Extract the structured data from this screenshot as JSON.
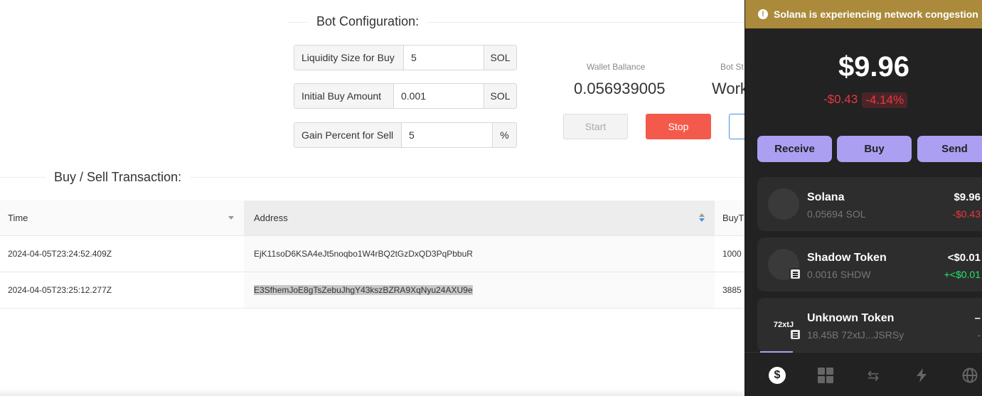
{
  "config": {
    "title": "Bot Configuration:",
    "fields": [
      {
        "label": "Liquidity Size for Buy",
        "value": "5",
        "unit": "SOL"
      },
      {
        "label": "Initial Buy Amount",
        "value": "0.001",
        "unit": "SOL"
      },
      {
        "label": "Gain Percent for Sell",
        "value": "5",
        "unit": "%"
      }
    ],
    "wallet_label": "Wallet Ballance",
    "wallet_value": "0.056939005",
    "bot_status_label": "Bot St",
    "bot_status_value": "Work",
    "start_label": "Start",
    "stop_label": "Stop"
  },
  "transactions": {
    "title": "Buy / Sell Transaction:",
    "columns": [
      "Time",
      "Address",
      "BuyT"
    ],
    "rows": [
      {
        "time": "2024-04-05T23:24:52.409Z",
        "address": "EjK11soD6KSA4eJt5noqbo1W4rBQ2tGzDxQD3PqPbbuR",
        "buy": "1000"
      },
      {
        "time": "2024-04-05T23:25:12.277Z",
        "address": "E3SfhemJoE8gTsZebuJhgY43kszBZRA9XqNyu24AXU9e",
        "buy": "3885"
      }
    ]
  },
  "wallet": {
    "banner": "Solana is experiencing network congestion",
    "balance": "$9.96",
    "change_abs": "-$0.43",
    "change_pct": "-4.14%",
    "actions": [
      "Receive",
      "Buy",
      "Send"
    ],
    "tokens": [
      {
        "name": "Solana",
        "amount": "0.05694 SOL",
        "value": "$9.96",
        "change": "-$0.43",
        "change_color": "#eb3742",
        "avatar": ""
      },
      {
        "name": "Shadow Token",
        "amount": "0.0016 SHDW",
        "value": "<$0.01",
        "change": "+<$0.01",
        "change_color": "#21e56f",
        "avatar": ""
      },
      {
        "name": "Unknown Token",
        "amount": "18.45B 72xtJ...JSRSy",
        "value": "–",
        "change": "-",
        "change_color": "#777777",
        "avatar": "72xtJ"
      }
    ],
    "nav_icons": [
      "dollar-icon",
      "grid-icon",
      "swap-icon",
      "bolt-icon",
      "globe-icon"
    ]
  }
}
